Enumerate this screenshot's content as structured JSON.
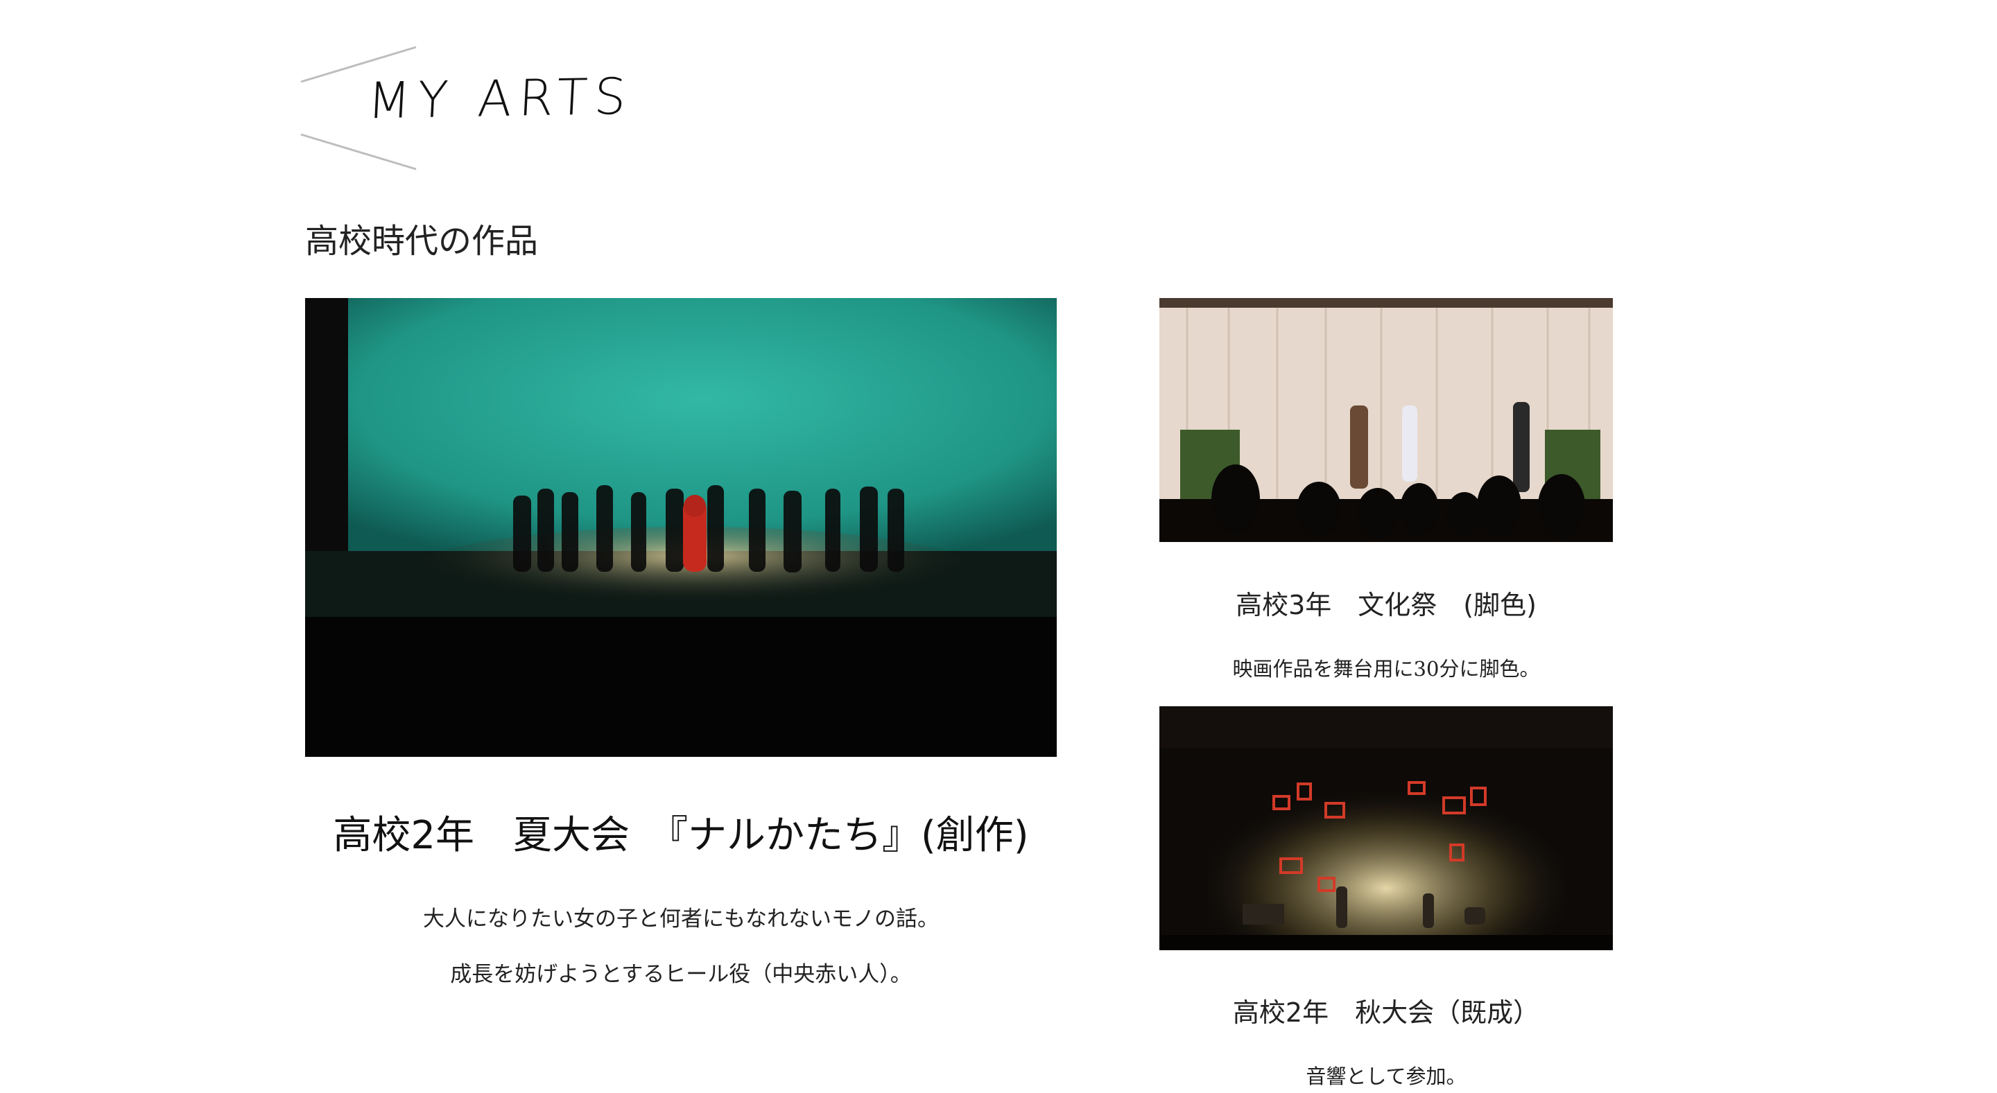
{
  "header": {
    "title": "MY ARTS",
    "section_title": "高校時代の作品"
  },
  "works": {
    "summer": {
      "title": "高校2年　夏大会　『ナルかたち』(創作)",
      "desc_1": "大人になりたい女の子と何者にもなれないモノの話。",
      "desc_2": "成長を妨げようとするヒール役（中央赤い人）。"
    },
    "festival": {
      "title": "高校3年　文化祭　(脚色)",
      "desc": "映画作品を舞台用に30分に脚色。"
    },
    "autumn": {
      "title": "高校2年　秋大会（既成）",
      "desc": "音響として参加。"
    }
  },
  "colors": {
    "background": "#ffffff",
    "text": "#1a1a1a",
    "stage_cyan": "#2aa89a",
    "accent_red": "#c62a1e"
  }
}
